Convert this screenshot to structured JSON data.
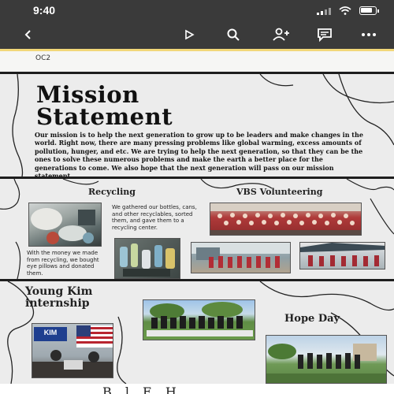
{
  "status_bar": {
    "time": "9:40",
    "icons": [
      "signal-icon",
      "wifi-icon",
      "battery-icon"
    ]
  },
  "toolbar": {
    "buttons": [
      "back-arrow-icon",
      "present-play-icon",
      "search-icon",
      "add-person-icon",
      "comment-icon",
      "more-icon"
    ]
  },
  "document": {
    "top_card_label": "OC2",
    "mission": {
      "title_line1": "Mission",
      "title_line2": "Statement",
      "body": "Our mission is to help the next generation to grow up to be leaders and make changes in the world. Right now, there are many pressing problems like global warming, excess amounts of pollution, hunger, and etc. We are trying to help the next generation, so that they can be the ones to solve these numerous problems and make the earth a better place for the generations to come. We also hope that the next generation will pass on our mission statement."
    },
    "recycling": {
      "title": "Recycling",
      "caption1": "We gathered our bottles, cans, and other recyclables, sorted them, and gave them to a recycling center.",
      "caption2": "With the money we made from recycling, we bought eye pillows and donated them."
    },
    "vbs": {
      "title": "VBS Volunteering"
    },
    "young_kim": {
      "title_line1": "Young Kim",
      "title_line2": "internship",
      "sign_text": "KIM"
    },
    "hope_day": {
      "title": "Hope Day"
    },
    "bottom_text": "B   l   E   H"
  },
  "colors": {
    "bar_bg": "#3a3a3a",
    "page_bg": "#ececec",
    "accent_yellow": "#f2d779",
    "ink": "#111111"
  }
}
